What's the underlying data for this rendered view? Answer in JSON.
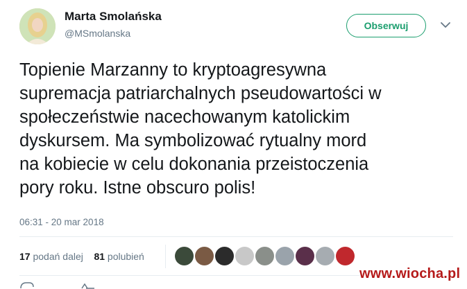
{
  "user": {
    "name": "Marta Smolańska",
    "handle": "@MSmolanska"
  },
  "follow_button": {
    "label": "Obserwuj",
    "color": "#1b9e6e"
  },
  "menu_icon": "chevron-down-icon",
  "tweet": {
    "lines": [
      "Topienie Marzanny to kryptoagresywna",
      "supremacja patriarchalnych pseudowartości w",
      "społeczeństwie nacechowanym katolickim",
      "dyskursem. Ma symbolizować rytualny mord",
      "na kobiecie w celu dokonania przeistoczenia",
      "pory roku. Istne obscuro polis!"
    ],
    "timestamp": "06:31 - 20 mar 2018"
  },
  "stats": {
    "retweets_count": "17",
    "retweets_label": "podań dalej",
    "likes_count": "81",
    "likes_label": "polubień"
  },
  "likers": [
    {
      "name": "liker-avatar-1",
      "color": "#3b4a3a"
    },
    {
      "name": "liker-avatar-2",
      "color": "#7a5a44"
    },
    {
      "name": "liker-avatar-3",
      "color": "#2b2b2b"
    },
    {
      "name": "liker-avatar-4",
      "color": "#c8c8c8"
    },
    {
      "name": "liker-avatar-5",
      "color": "#8a8f8a"
    },
    {
      "name": "liker-avatar-6",
      "color": "#9aa3ab"
    },
    {
      "name": "liker-avatar-7",
      "color": "#5a2f4a"
    },
    {
      "name": "liker-avatar-8",
      "color": "#a6acb1"
    },
    {
      "name": "liker-avatar-9",
      "color": "#c0282d"
    }
  ],
  "watermark": "www.wiocha.pl"
}
